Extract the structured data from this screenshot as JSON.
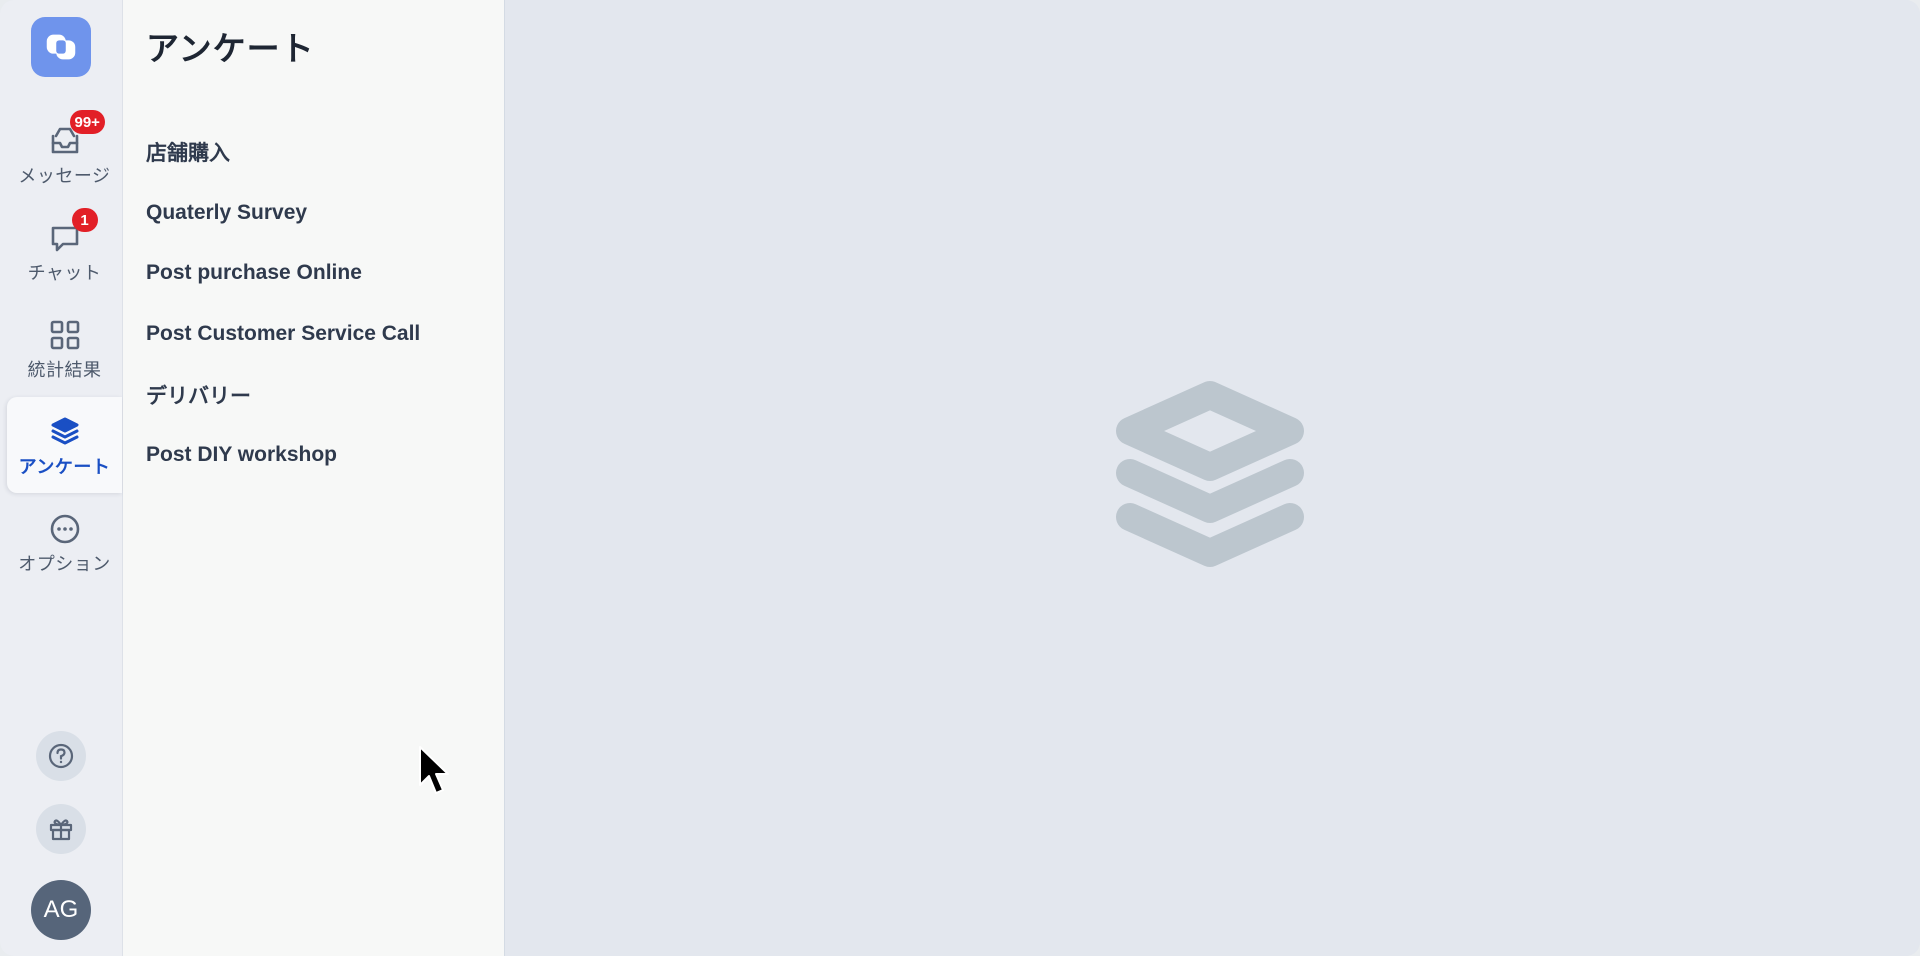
{
  "rail": {
    "logo_icon": "app-logo-icon",
    "items": [
      {
        "label": "メッセージ",
        "icon": "inbox-icon",
        "badge": "99+",
        "active": false
      },
      {
        "label": "チャット",
        "icon": "chat-bubble-icon",
        "badge": "1",
        "active": false
      },
      {
        "label": "統計結果",
        "icon": "grid-icon",
        "badge": null,
        "active": false
      },
      {
        "label": "アンケート",
        "icon": "stack-layers-icon",
        "badge": null,
        "active": true
      },
      {
        "label": "オプション",
        "icon": "more-dots-icon",
        "badge": null,
        "active": false
      }
    ],
    "help_icon": "help-circle-icon",
    "gift_icon": "gift-icon",
    "avatar_initials": "AG"
  },
  "panel": {
    "title": "アンケート",
    "surveys": [
      "店舗購入",
      "Quaterly Survey",
      "Post purchase Online",
      "Post Customer Service Call",
      "デリバリー",
      "Post DIY workshop"
    ]
  },
  "main": {
    "empty_icon": "stack-layers-icon"
  },
  "colors": {
    "accent": "#1a4fc4",
    "logo_bg": "#6f94ec",
    "badge": "#e21f27",
    "placeholder_icon": "#bcc6ce"
  }
}
